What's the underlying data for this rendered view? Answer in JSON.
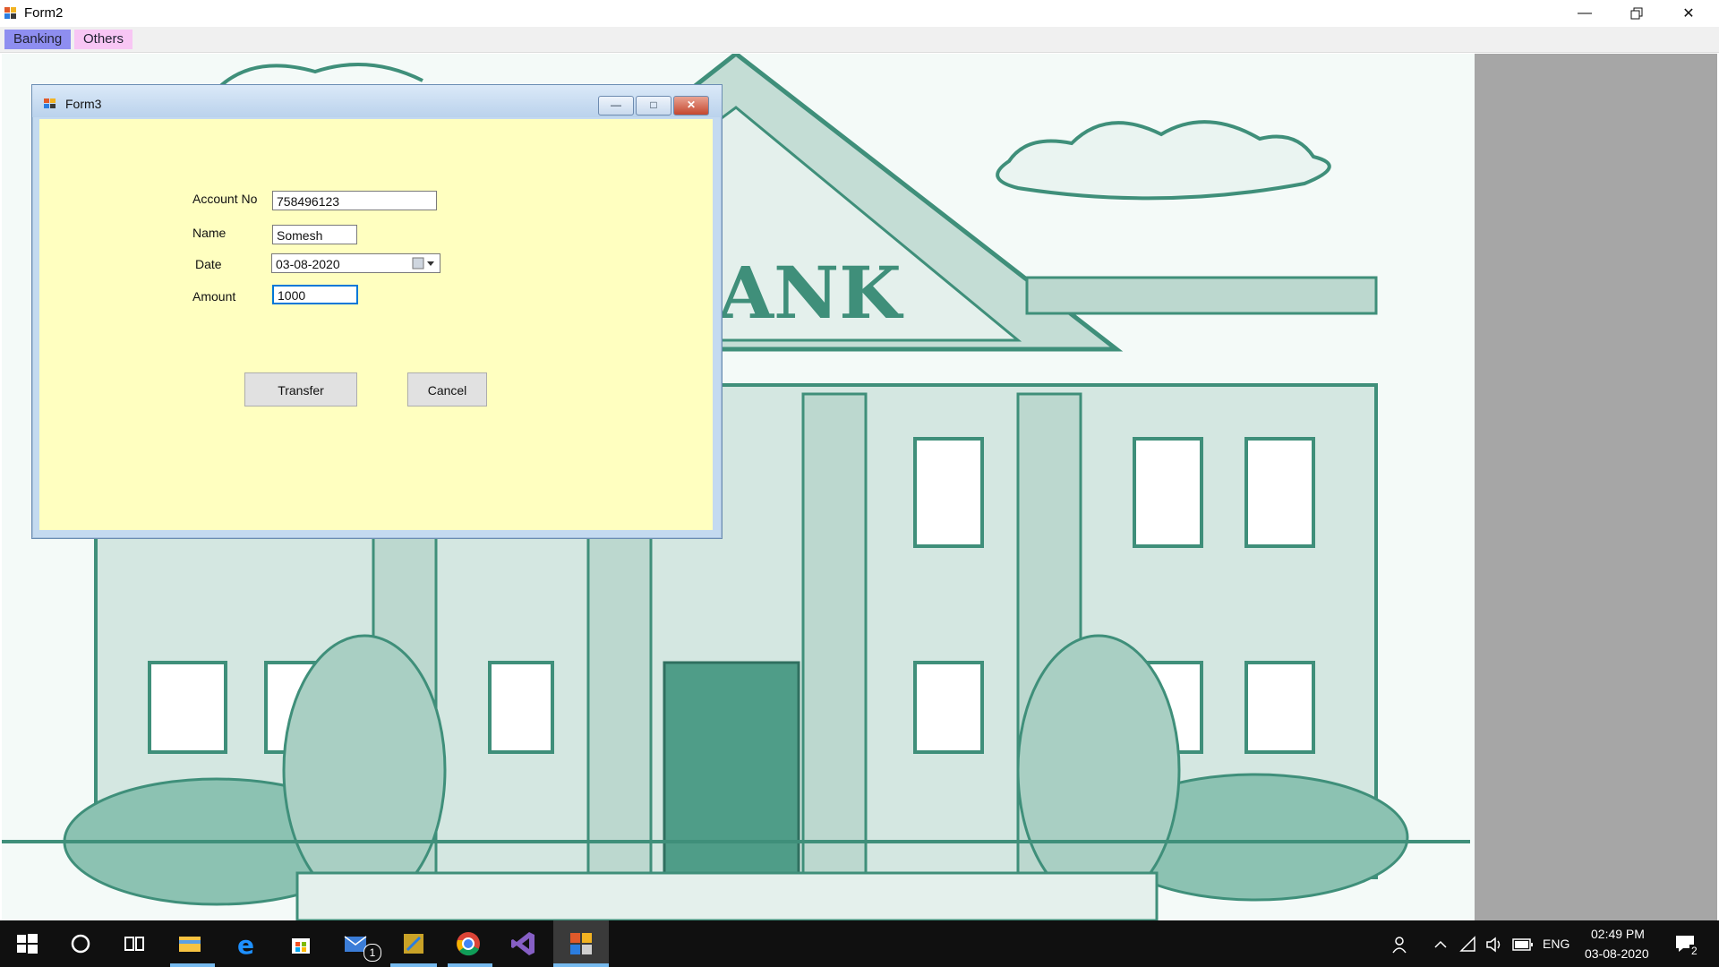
{
  "window": {
    "title": "Form2"
  },
  "menu": {
    "banking": "Banking",
    "others": "Others"
  },
  "background": {
    "sign_text": "ANK"
  },
  "form3": {
    "title": "Form3",
    "fields": {
      "account_no_label": "Account No",
      "account_no_value": "758496123",
      "name_label": "Name",
      "name_value": "Somesh",
      "date_label": "Date",
      "date_value": "03-08-2020",
      "amount_label": "Amount",
      "amount_value": "1000"
    },
    "buttons": {
      "transfer": "Transfer",
      "cancel": "Cancel"
    }
  },
  "taskbar": {
    "mail_badge": "1",
    "language": "ENG",
    "time": "02:49 PM",
    "date": "03-08-2020",
    "notification_count": "2",
    "icons": [
      "windows-start-icon",
      "cortana-icon",
      "task-view-icon",
      "file-explorer-icon",
      "edge-icon",
      "store-icon",
      "mail-icon",
      "snip-icon",
      "chrome-icon",
      "visual-studio-icon",
      "winforms-app-icon"
    ]
  },
  "colors": {
    "form3_body": "#ffffc0",
    "banking_menu": "#8e8ef0",
    "others_menu": "#f8c6f4",
    "art_green": "#3f8f7a"
  }
}
